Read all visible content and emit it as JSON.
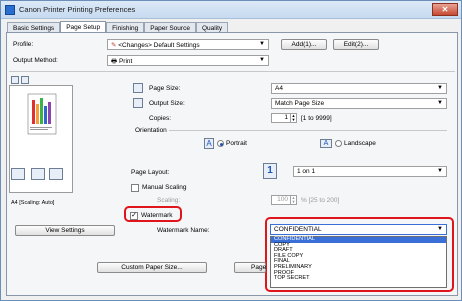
{
  "window": {
    "title": "Canon Printer Printing Preferences",
    "close": "✕"
  },
  "tabs": [
    "Basic Settings",
    "Page Setup",
    "Finishing",
    "Paper Source",
    "Quality"
  ],
  "profile": {
    "label": "Profile:",
    "value": "<Changes> Default Settings",
    "add": "Add(1)...",
    "edit": "Edit(2)..."
  },
  "output_method": {
    "label": "Output Method:",
    "value": "Print"
  },
  "page_size": {
    "label": "Page Size:",
    "value": "A4"
  },
  "output_size": {
    "label": "Output Size:",
    "value": "Match Page Size"
  },
  "copies": {
    "label": "Copies:",
    "value": "1",
    "range": "[1 to 9999]"
  },
  "orientation": {
    "label": "Orientation",
    "portrait": "Portrait",
    "landscape": "Landscape",
    "a_glyph": "A"
  },
  "page_layout": {
    "label": "Page Layout:",
    "value": "1 on 1",
    "icon_num": "1"
  },
  "manual_scaling": {
    "label": "Manual Scaling",
    "scaling_label": "Scaling:",
    "value": "100",
    "range": "% [25 to 200]"
  },
  "preview": {
    "caption": "A4 [Scaling: Auto]"
  },
  "view_settings": "View Settings",
  "watermark": {
    "label": "Watermark",
    "name_label": "Watermark Name:",
    "value": "CONFIDENTIAL",
    "options": [
      "CONFIDENTIAL",
      "COPY",
      "DRAFT",
      "FILE COPY",
      "FINAL",
      "PRELIMINARY",
      "PROOF",
      "TOP SECRET"
    ]
  },
  "custom_paper": "Custom Paper Size...",
  "page_options": "Page"
}
